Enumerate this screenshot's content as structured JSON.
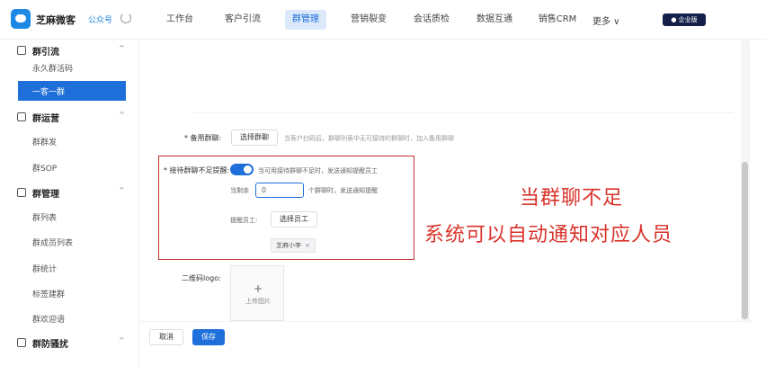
{
  "header": {
    "brand": "芝麻微客",
    "account": "公众号",
    "nav": [
      "工作台",
      "客户引流",
      "群管理",
      "营销裂变",
      "会话质检",
      "数据互通",
      "销售CRM"
    ],
    "active_nav": "群管理",
    "more": "更多 ∨",
    "edition": "● 企业版"
  },
  "sidebar": {
    "groups": [
      {
        "label": "群引流",
        "items": [
          "永久群活码",
          "一客一群"
        ]
      },
      {
        "label": "群运营",
        "items": [
          "群群发",
          "群SOP"
        ]
      },
      {
        "label": "群管理",
        "items": [
          "群列表",
          "群成员列表",
          "群统计",
          "标签建群",
          "群欢迎语"
        ]
      },
      {
        "label": "群防骚扰",
        "items": []
      }
    ],
    "active_item": "一客一群"
  },
  "form": {
    "backup_group_label": "* 备用群聊:",
    "backup_group_button": "选择群聊",
    "backup_group_hint": "当客户扫码后，群聊列表中无可接待的群聊时，加入备用群聊",
    "remind_label": "* 接待群聊不足提醒:",
    "remind_hint": "当可用接待群聊不足时，发送通知提醒员工",
    "remaining_prefix": "当剩余",
    "remaining_value": "0",
    "remaining_suffix": "个群聊时，发送通知提醒",
    "staff_label": "提醒员工:",
    "staff_button": "选择员工",
    "staff_tag": "芝麻小李",
    "qr_logo_label": "二维码logo:",
    "upload_plus": "+",
    "upload_text": "上传图片"
  },
  "annotation": {
    "line1": "当群聊不足",
    "line2": "系统可以自动通知对应人员"
  },
  "footer": {
    "cancel": "取消",
    "save": "保存"
  },
  "colors": {
    "primary": "#1e6fd9",
    "annotation": "#d9332b",
    "highlight_border": "#c0302b"
  }
}
